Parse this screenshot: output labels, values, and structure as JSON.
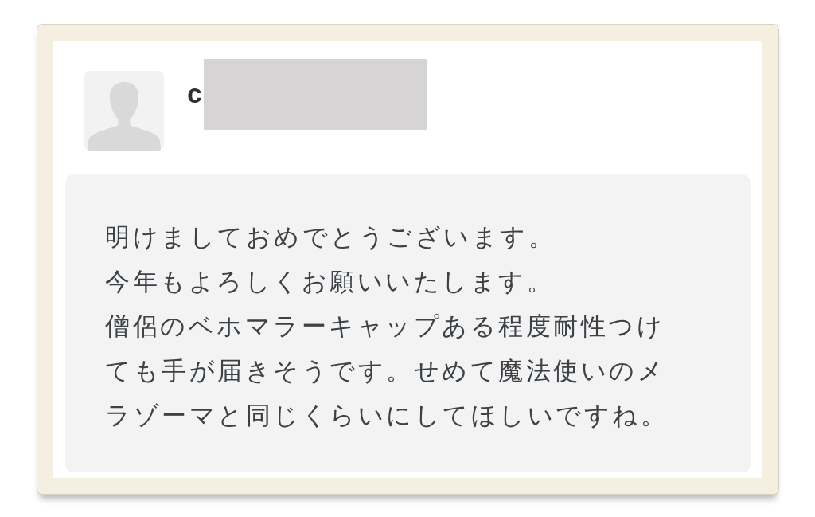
{
  "author": {
    "name": "c",
    "name_redacted": true
  },
  "comment": {
    "paragraphs": [
      "明けましておめでとうございます。",
      "今年もよろしくお願いいたします。",
      "僧侶のベホマラーキャップある程度耐性つけても手が届きそうです。せめて魔法使いのメラゾーマと同じくらいにしてほしいですね。"
    ]
  }
}
